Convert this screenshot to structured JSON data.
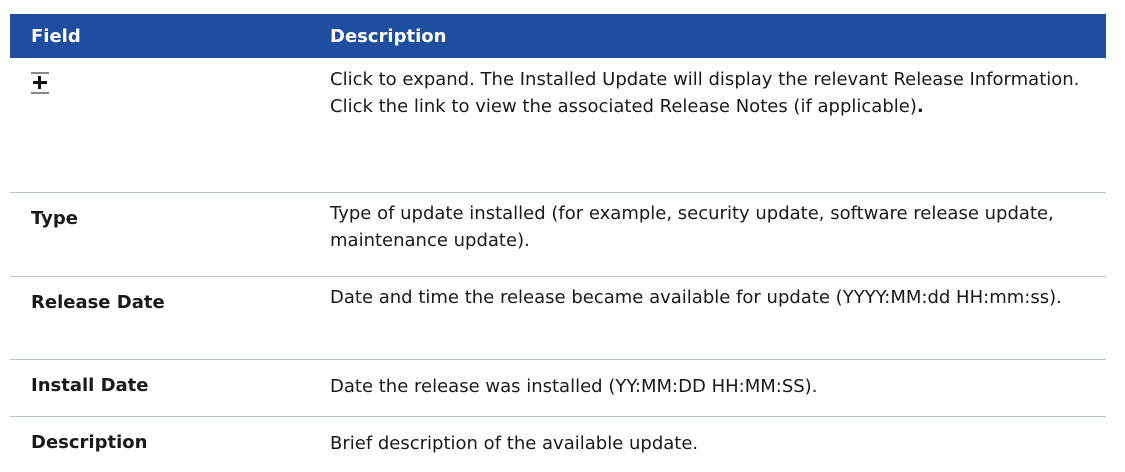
{
  "header": {
    "field_label": "Field",
    "description_label": "Description"
  },
  "rows": [
    {
      "field_icon": "expand-plus-icon",
      "description": "Click to expand. The Installed Update will display the relevant Release Information. Click the link to view the associated Release Notes (if applicable)",
      "description_suffix": "."
    },
    {
      "field": "Type",
      "description": "Type of update installed (for example, security update, software release update, maintenance update)."
    },
    {
      "field": "Release Date",
      "description": "Date and time the release became available for update (YYYY:MM:dd HH:mm:ss)."
    },
    {
      "field": "Install Date",
      "description": "Date the release was installed (YY:MM:DD HH:MM:SS)."
    },
    {
      "field": "Description",
      "description": "Brief description of the available update."
    }
  ],
  "colors": {
    "header_bg": "#1f4ea1",
    "header_text": "#ffffff",
    "row_divider": "#b9c3d3"
  }
}
